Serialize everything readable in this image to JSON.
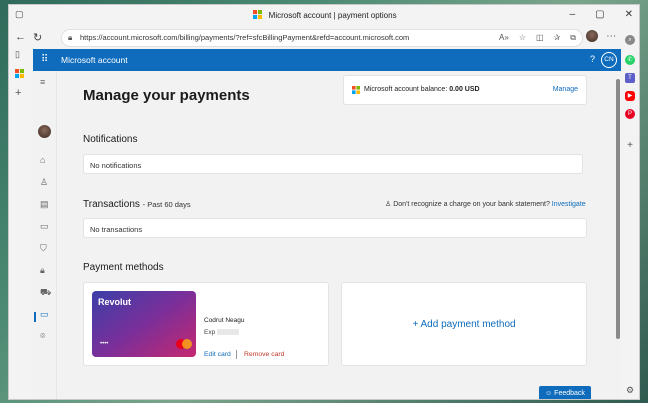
{
  "browser": {
    "window_title": "Microsoft account | payment options",
    "url": "https://account.microsoft.com/billing/payments/?ref=sfcBillingPayment&refd=account.microsoft.com"
  },
  "header": {
    "brand": "Microsoft account",
    "help": "?",
    "user_initials": "CN"
  },
  "main": {
    "title": "Manage your payments",
    "balance": {
      "label": "Microsoft account balance:",
      "amount": "0.00 USD",
      "manage": "Manage"
    },
    "notifications": {
      "title": "Notifications",
      "empty": "No notifications"
    },
    "transactions": {
      "title": "Transactions",
      "subtitle": "- Past 60 days",
      "unrecognized": "Don't recognize a charge on your bank statement?",
      "investigate": "Investigate",
      "empty": "No transactions"
    },
    "payment_methods": {
      "title": "Payment methods",
      "card": {
        "brand": "Revolut",
        "number_mask": "••••",
        "holder": "Codrut Neagu",
        "exp_label": "Exp",
        "edit": "Edit card",
        "remove": "Remove card"
      },
      "add": "+ Add payment method"
    },
    "feedback": "Feedback"
  },
  "colors": {
    "accent": "#0f6cbd",
    "remove": "#c0392b"
  }
}
